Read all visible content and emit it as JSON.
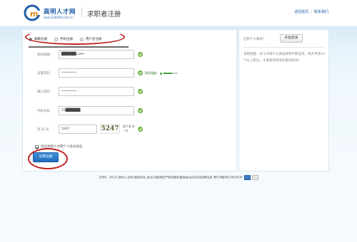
{
  "header": {
    "logo_name": "高明人才网",
    "logo_url": "www.528000.com.cn",
    "page_title": "求职者注册",
    "links": [
      "返回首页",
      "联系我们"
    ]
  },
  "tabs": [
    {
      "label": "邮箱注册",
      "selected": true
    },
    {
      "label": "手机注册",
      "selected": false
    },
    {
      "label": "用户名注册",
      "selected": false
    }
  ],
  "form": {
    "email": {
      "label": "我的邮箱",
      "value": "██████.com"
    },
    "password": {
      "label": "设置密码",
      "value": "••••••••"
    },
    "strength": {
      "label": "密码强度："
    },
    "confirm": {
      "label": "确认密码",
      "value": "••••••••"
    },
    "phone": {
      "label": "手机号码",
      "value": "15██████"
    },
    "captcha": {
      "label": "验 证 码",
      "value": "5247",
      "image_text": "5247",
      "refresh": "看不清 换一张"
    },
    "agree": {
      "label": "阅读高明人才网个人会员协议",
      "checked": true
    },
    "submit": "立即注册"
  },
  "side": {
    "have_account": "已有个人账号？",
    "login_button": "开始登录",
    "tip": "求职提醒：好工作来于认真选择和不断追求。每天申请10个以上职位，才能获得更多的面试机会！"
  },
  "footer": {
    "text": "2008 - 2014 高明人才网 版权所有 本站书面授权严禁转载和复制本站的任何招聘信息 粤ICP备06100391号"
  },
  "colors": {
    "brand_blue": "#1d5fa6",
    "ok_green": "#6ab23e",
    "annotation_red": "#c0201e"
  }
}
